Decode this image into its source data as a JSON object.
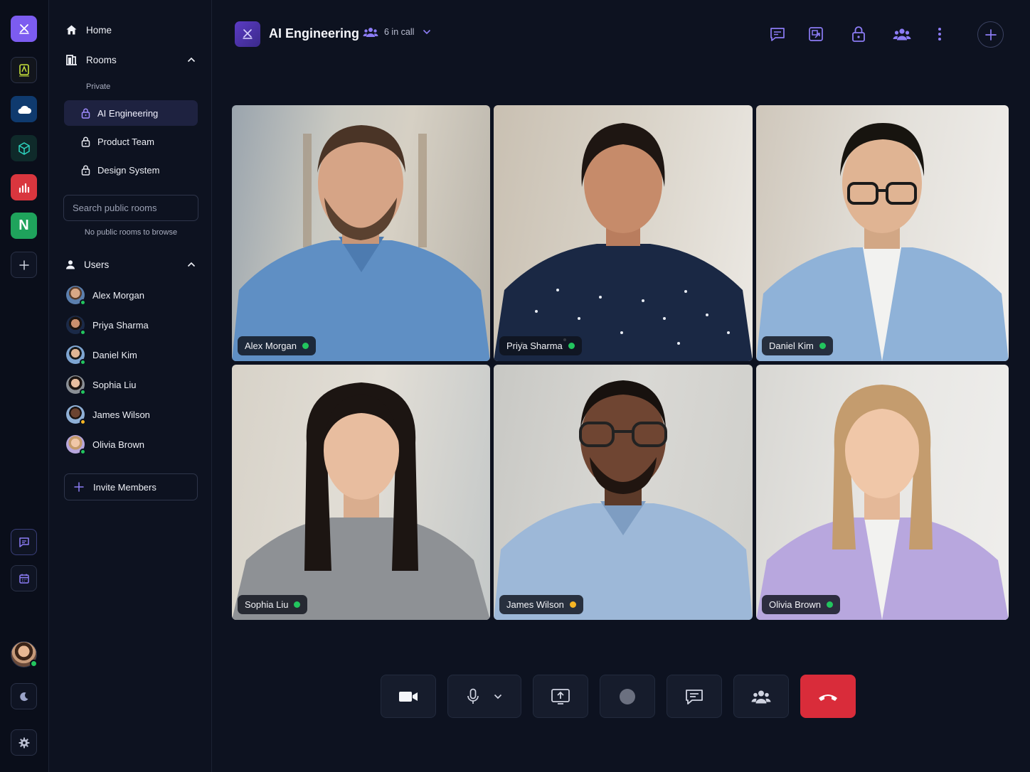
{
  "rail": {
    "apps": [
      "app-logo-icon",
      "wordmark-app-icon",
      "cloud-icon",
      "cube-icon",
      "bar-chart-icon",
      "notion-n-icon"
    ],
    "n_letter": "N",
    "accent": "#7c5cf0"
  },
  "sidebar": {
    "home_label": "Home",
    "rooms_label": "Rooms",
    "private_label": "Private",
    "rooms": [
      {
        "label": "AI Engineering",
        "active": true
      },
      {
        "label": "Product Team",
        "active": false
      },
      {
        "label": "Design System",
        "active": false
      }
    ],
    "search_placeholder": "Search public rooms",
    "no_public_rooms": "No public rooms to browse",
    "users_label": "Users",
    "users": [
      {
        "name": "Alex Morgan",
        "status": "online"
      },
      {
        "name": "Priya Sharma",
        "status": "online"
      },
      {
        "name": "Daniel Kim",
        "status": "online"
      },
      {
        "name": "Sophia Liu",
        "status": "online"
      },
      {
        "name": "James Wilson",
        "status": "away"
      },
      {
        "name": "Olivia Brown",
        "status": "online"
      }
    ],
    "invite_label": "Invite Members"
  },
  "header": {
    "room_title": "AI Engineering",
    "in_call": "6 in call"
  },
  "participants": [
    {
      "name": "Alex Morgan",
      "status": "online"
    },
    {
      "name": "Priya Sharma",
      "status": "online"
    },
    {
      "name": "Daniel Kim",
      "status": "online"
    },
    {
      "name": "Sophia Liu",
      "status": "online"
    },
    {
      "name": "James Wilson",
      "status": "away"
    },
    {
      "name": "Olivia Brown",
      "status": "online"
    }
  ],
  "colors": {
    "online": "#22c55e",
    "away": "#f5b524",
    "end_call": "#d92c3a",
    "accent": "#7c5cf0"
  }
}
